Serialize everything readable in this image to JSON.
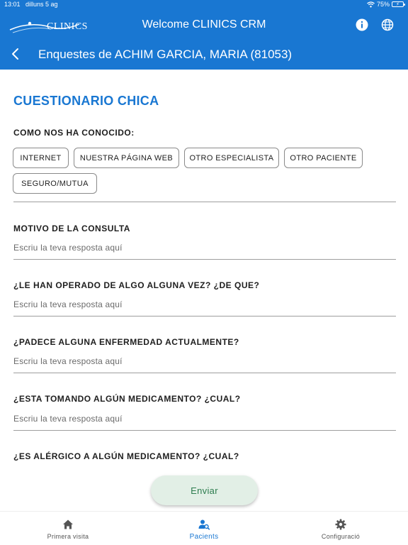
{
  "status_bar": {
    "time": "13:01",
    "date": "dilluns 5 ag",
    "battery": "75%"
  },
  "header": {
    "logo_text": "CLINICS",
    "app_title": "Welcome CLINICS CRM",
    "subtitle": "Enquestes de  ACHIM GARCIA, MARIA (81053)"
  },
  "form": {
    "title": "CUESTIONARIO CHICA",
    "how_label": "COMO NOS HA CONOCIDO:",
    "options": [
      "INTERNET",
      "NUESTRA PÁGINA WEB",
      "OTRO ESPECIALISTA",
      "OTRO PACIENTE",
      "SEGURO/MUTUA"
    ],
    "questions": [
      {
        "label": "MOTIVO DE LA CONSULTA",
        "placeholder": "Escriu la teva resposta aquí"
      },
      {
        "label": "¿LE HAN OPERADO DE ALGO ALGUNA VEZ? ¿DE QUE?",
        "placeholder": "Escriu la teva resposta aquí"
      },
      {
        "label": "¿PADECE ALGUNA ENFERMEDAD ACTUALMENTE?",
        "placeholder": "Escriu la teva resposta aquí"
      },
      {
        "label": "¿ESTA TOMANDO ALGÚN MEDICAMENTO? ¿CUAL?",
        "placeholder": "Escriu la teva resposta aquí"
      },
      {
        "label": "¿ES ALÉRGICO A ALGÚN MEDICAMENTO? ¿CUAL?",
        "placeholder": ""
      }
    ],
    "send_label": "Enviar"
  },
  "bottom_nav": [
    {
      "label": "Primera visita",
      "icon": "home-icon",
      "active": false
    },
    {
      "label": "Pacients",
      "icon": "patient-search-icon",
      "active": true
    },
    {
      "label": "Configuració",
      "icon": "gear-icon",
      "active": false
    }
  ],
  "colors": {
    "primary": "#1977d2",
    "send_button_bg": "#e2efe6",
    "send_button_text": "#2e7d4f"
  }
}
